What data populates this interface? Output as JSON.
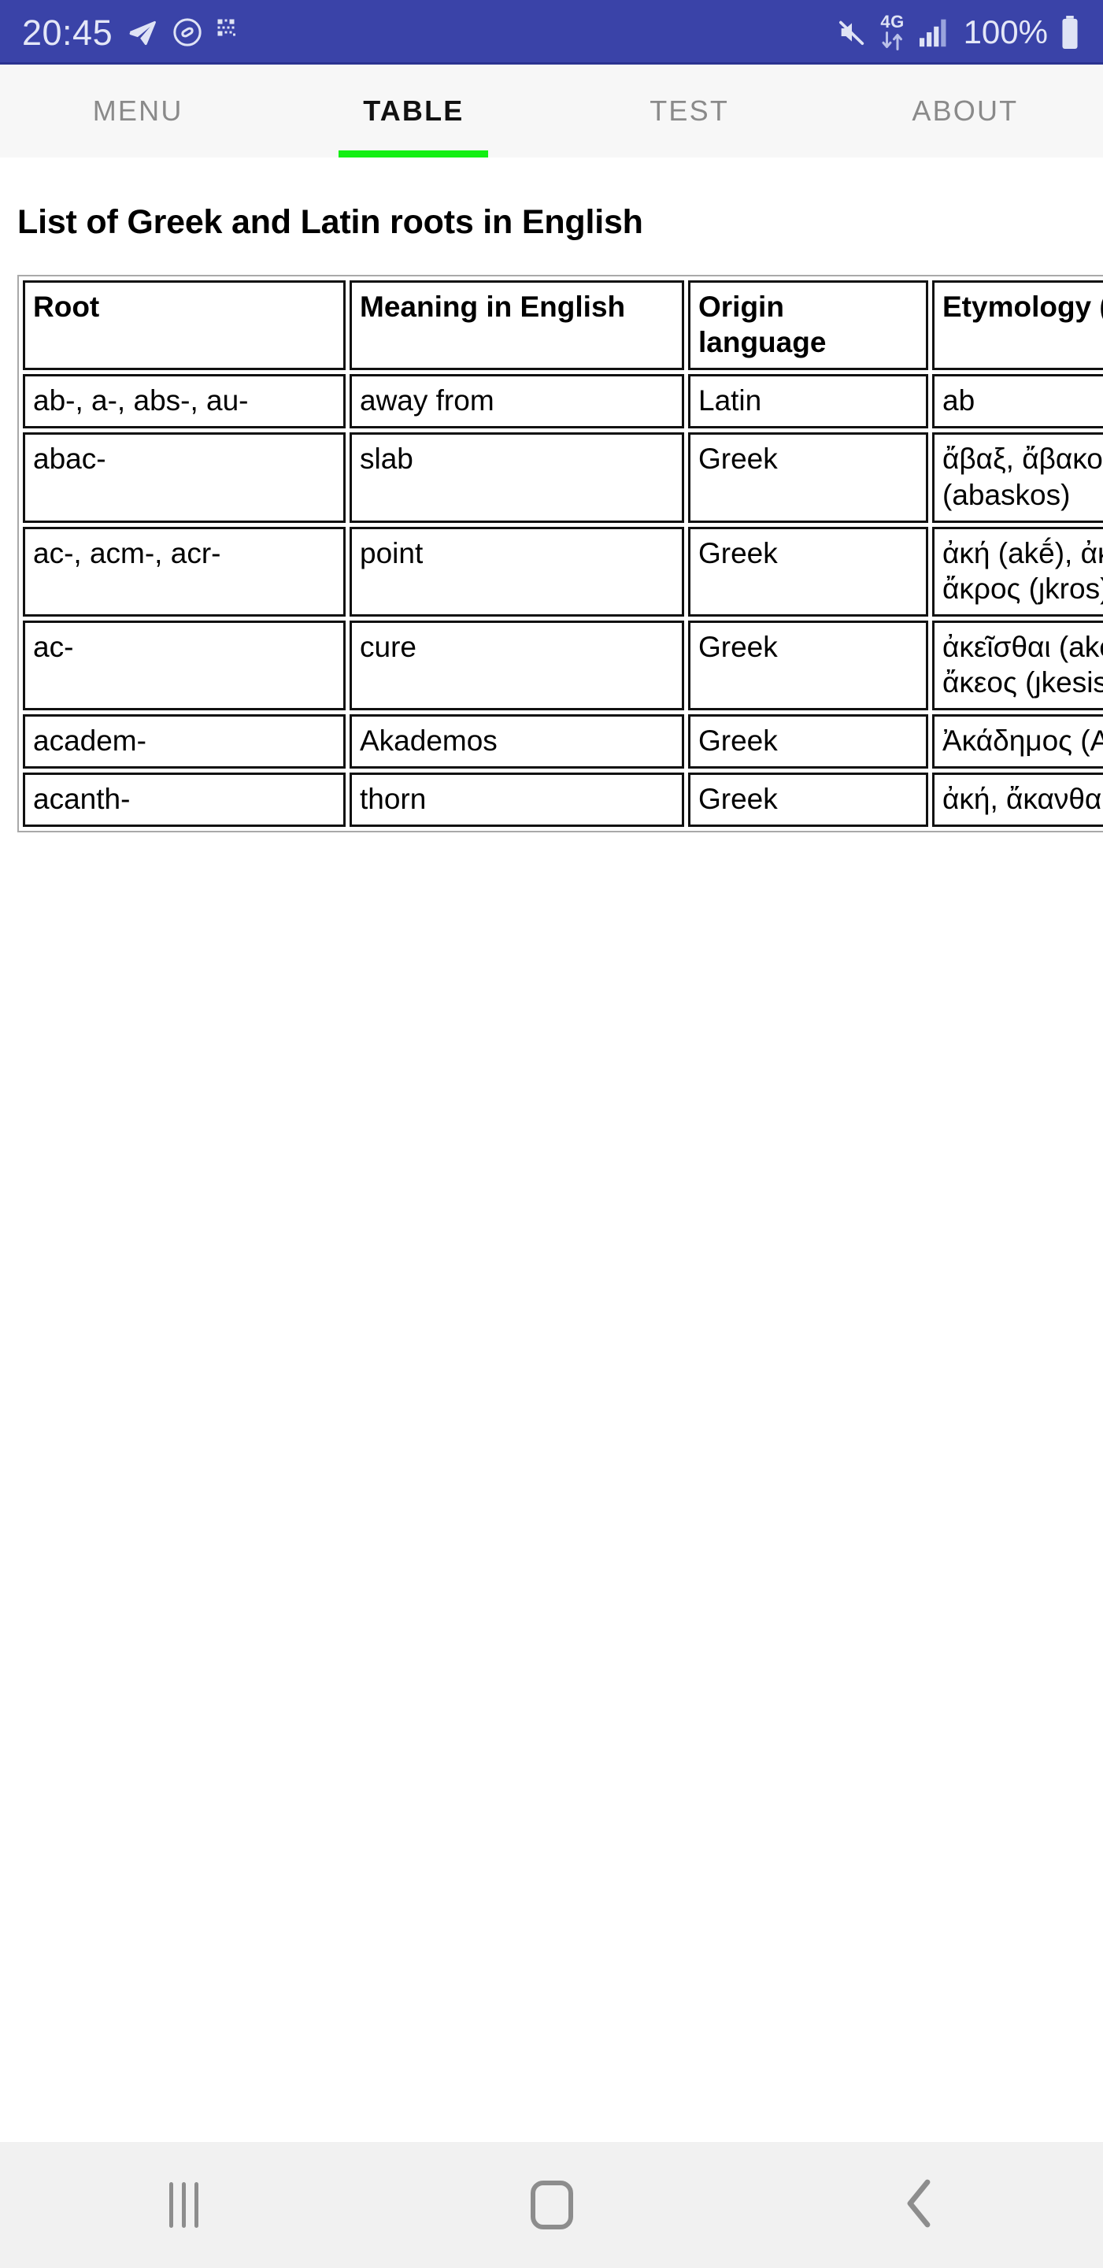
{
  "status_bar": {
    "time": "20:45",
    "battery_percent": "100%",
    "network_label": "4G",
    "left_icons": [
      "telegram-icon",
      "shazam-icon",
      "qr-code-icon"
    ],
    "right_icons": [
      "mute-icon",
      "mobile-data-icon",
      "signal-bars-icon",
      "battery-icon"
    ],
    "background_color": "#3a43a8"
  },
  "tabs": {
    "active_indicator_color": "#13ef13",
    "items": [
      {
        "label": "MENU",
        "active": false
      },
      {
        "label": "TABLE",
        "active": true
      },
      {
        "label": "TEST",
        "active": false
      },
      {
        "label": "ABOUT",
        "active": false
      }
    ]
  },
  "page": {
    "title": "List of Greek and Latin roots in English"
  },
  "table": {
    "headers": [
      "Root",
      "Meaning in English",
      "Origin language",
      "Etymology (root origin)"
    ],
    "rows": [
      {
        "root": "ab-, a-, abs-, au-",
        "meaning": "away from",
        "origin": "Latin",
        "etymology": "ab"
      },
      {
        "root": "abac-",
        "meaning": "slab",
        "origin": "Greek",
        "etymology": "ἄβαξ, ἄβακος (ȷbaks, ȷbakos), ἀβακίσκος (abaskos)"
      },
      {
        "root": "ac-, acm-, acr-",
        "meaning": "point",
        "origin": "Greek",
        "etymology": "ἀκή (akḗ), ἀκίδος (akdos), ἀκμή (aknē), ἄκρος (ȷkros), ἄκρον (ȷkron), ἄκρα"
      },
      {
        "root": "ac-",
        "meaning": "cure",
        "origin": "Greek",
        "etymology": "ἀκεῖσθαι (akesthai), ἀκή (akḗ), ἄκεσις, ἄκεος (ȷkesis, ȷkeos)"
      },
      {
        "root": "academ-",
        "meaning": "Akademos",
        "origin": "Greek",
        "etymology": "Ἀκάδημος (Akȷdēmos)"
      },
      {
        "root": "acanth-",
        "meaning": "thorn",
        "origin": "Greek",
        "etymology": "ἀκή, ἄκανθα (ȷkantha)"
      }
    ]
  },
  "nav_bar": {
    "buttons": [
      "recents-button",
      "home-button",
      "back-button"
    ]
  }
}
